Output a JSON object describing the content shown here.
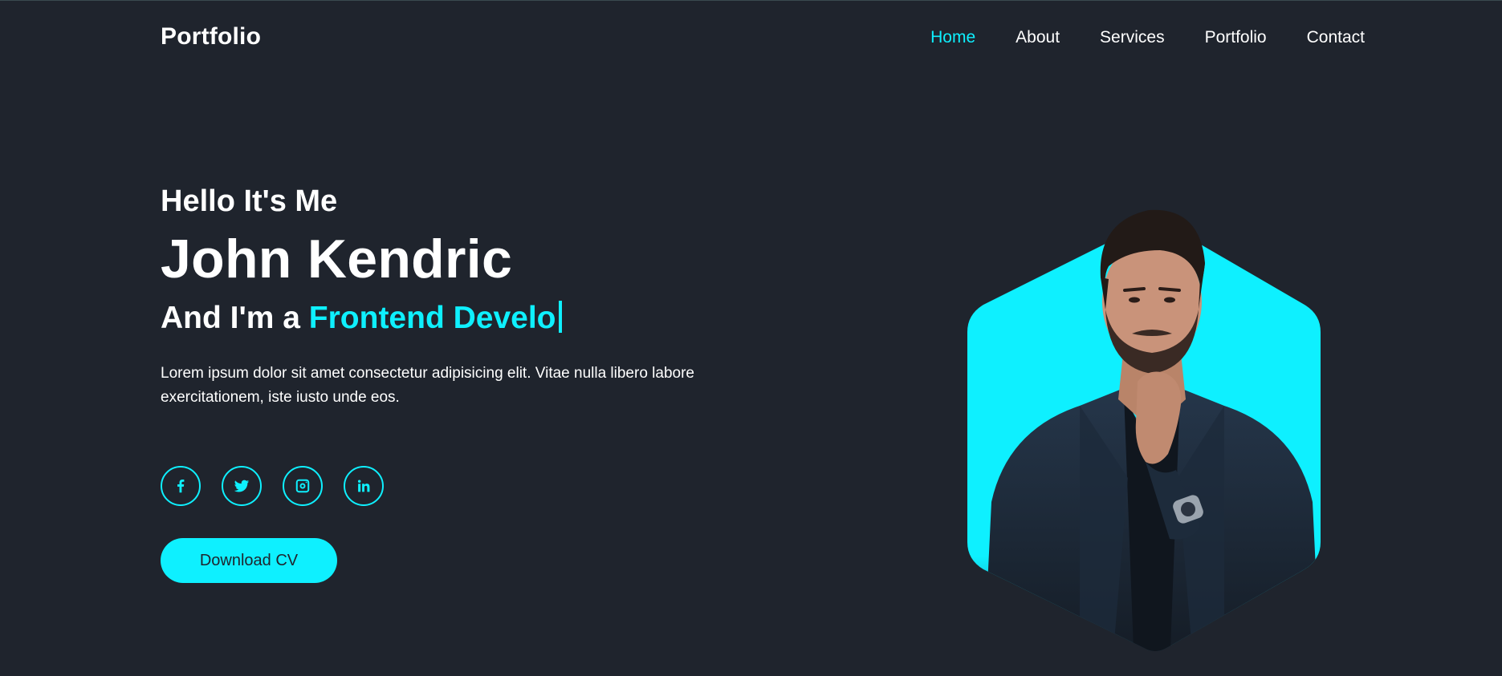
{
  "header": {
    "logo": "Portfolio",
    "nav": [
      "Home",
      "About",
      "Services",
      "Portfolio",
      "Contact"
    ],
    "active": "Home"
  },
  "hero": {
    "greeting": "Hello It's Me",
    "name": "John Kendric",
    "role_prefix": "And I'm a ",
    "role_typed": "Frontend Develo",
    "description": "Lorem ipsum dolor sit amet consectetur adipisicing elit. Vitae nulla libero labore exercitationem, iste iusto unde eos.",
    "button": "Download CV"
  },
  "social": [
    "facebook-icon",
    "twitter-icon",
    "instagram-icon",
    "linkedin-icon"
  ],
  "colors": {
    "background": "#1f242d",
    "accent": "#0ef0ff",
    "text": "#ffffff"
  }
}
